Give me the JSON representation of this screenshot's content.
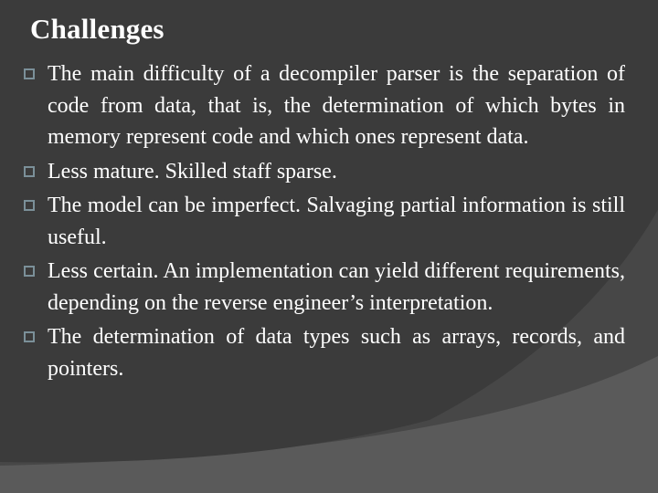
{
  "slide": {
    "title": "Challenges",
    "bullet_icon": "hollow-square-bullet",
    "colors": {
      "background_dark": "#3b3b3b",
      "background_arc": "#444444",
      "background_band": "#5a5a5a",
      "text": "#ffffff",
      "bullet": "#7b9099"
    },
    "items": [
      {
        "text": "The main difficulty of a decompiler parser is the separation of code from data, that is, the determination of which bytes in memory represent code and which ones represent data."
      },
      {
        "text": "Less mature. Skilled staff  sparse."
      },
      {
        "text": "The model can be imperfect. Salvaging partial information is still useful."
      },
      {
        "text": "Less certain. An implementation can yield different requirements, depending on the reverse engineer’s interpretation."
      },
      {
        "text": "The determination of data types such as arrays, records, and pointers."
      }
    ]
  }
}
